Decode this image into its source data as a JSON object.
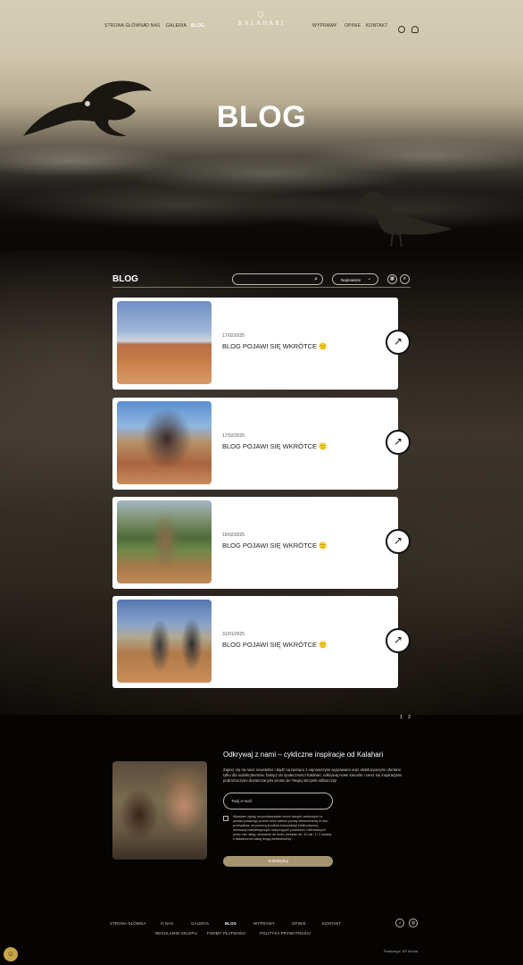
{
  "nav": {
    "left": [
      {
        "label": "Strona główna"
      },
      {
        "label": "O nas"
      },
      {
        "label": "Galeria"
      },
      {
        "label": "Blog",
        "active": true
      }
    ],
    "right": [
      {
        "label": "Wyprawy"
      },
      {
        "label": "Opinie"
      },
      {
        "label": "Kontakt"
      }
    ],
    "logo": "KALAHARI"
  },
  "hero": {
    "title": "BLOG"
  },
  "blog": {
    "label": "BLOG",
    "search_placeholder": "",
    "sort_value": "Najnowsze",
    "posts": [
      {
        "date": "17/02/2025",
        "title": "BLOG POJAWI SIĘ WKRÓTCE 🙂"
      },
      {
        "date": "17/02/2025",
        "title": "BLOG POJAWI SIĘ WKRÓTCE 🙂"
      },
      {
        "date": "16/02/2025",
        "title": "BLOG POJAWI SIĘ WKRÓTCE 🙂"
      },
      {
        "date": "31/01/2025",
        "title": "BLOG POJAWI SIĘ WKRÓTCE 🙂"
      }
    ],
    "pages": [
      "1",
      "2"
    ]
  },
  "newsletter": {
    "title": "Odkrywaj z nami – cykliczne inspiracje od Kalahari",
    "text": "Zapisz się na nasz newsletter i bądź na bieżąco z najnowszymi wyprawami oraz ekskluzywnymi ofertami tylko dla subskrybentów. Dołącz do społeczności Kalahari, odkrywaj nowe kierunki i ciesz się inspiracjami podróżniczymi dostarczanymi prosto do Twojej skrzynki odbiorczej!",
    "email_placeholder": "Twój e-mail",
    "consent": "Wyrażam zgodę na przetwarzanie moich danych osobowych w postaci podanego przeze mnie adresu poczty elektronicznej w celu przesyłania, za pomocą środków komunikacji elektronicznej, informacji marketingowych dotyczących produktów i oferowanych przez nas usług, stosownie do treści przepisu art. 10 ust. 1 i 2 ustawy o świadczeniu usług drogą elektroniczną*.",
    "button": "Subskrybuj"
  },
  "footer": {
    "row1": [
      "Strona główna",
      "O nas",
      "Galeria",
      "Blog",
      "Wyprawy",
      "Opinie",
      "Kontakt"
    ],
    "row2": [
      "Regulamin sklepu",
      "Formy płatności",
      "Polityka prywatności"
    ],
    "credit": "Realizacja: SP Media"
  },
  "colors": {
    "accent": "#a69470",
    "background": "#050403"
  }
}
